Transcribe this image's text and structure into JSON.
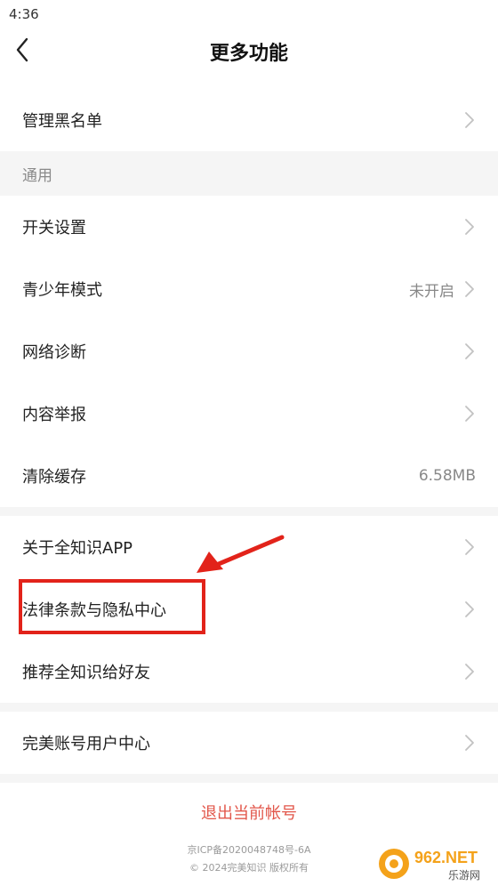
{
  "status_bar": {
    "time": "4:36"
  },
  "nav": {
    "title": "更多功能"
  },
  "rows_top": [
    {
      "label": "管理黑名单",
      "chevron": true
    }
  ],
  "section_general": {
    "label": "通用"
  },
  "rows_general": [
    {
      "label": "开关设置",
      "value": "",
      "chevron": true
    },
    {
      "label": "青少年模式",
      "value": "未开启",
      "chevron": true
    },
    {
      "label": "网络诊断",
      "value": "",
      "chevron": true
    },
    {
      "label": "内容举报",
      "value": "",
      "chevron": true
    },
    {
      "label": "清除缓存",
      "value": "6.58MB",
      "chevron": false
    }
  ],
  "rows_about": [
    {
      "label": "关于全知识APP",
      "chevron": true
    },
    {
      "label": "法律条款与隐私中心",
      "chevron": true
    },
    {
      "label": "推荐全知识给好友",
      "chevron": true
    }
  ],
  "rows_account": [
    {
      "label": "完美账号用户中心",
      "chevron": true
    }
  ],
  "logout": {
    "label": "退出当前帐号"
  },
  "footer": {
    "icp": "京ICP备2020048748号-6A",
    "copyright": "© 2024完美知识 版权所有"
  },
  "watermark": {
    "brand": "962.NET",
    "site": "乐游网"
  },
  "colors": {
    "accent_red": "#e2564a",
    "highlight_red": "#e2231a",
    "section_bg": "#f5f5f5",
    "secondary_text": "#888888"
  },
  "icons": {
    "back": "chevron-left-icon",
    "row": "chevron-right-icon",
    "annotation": "red-arrow-icon"
  }
}
